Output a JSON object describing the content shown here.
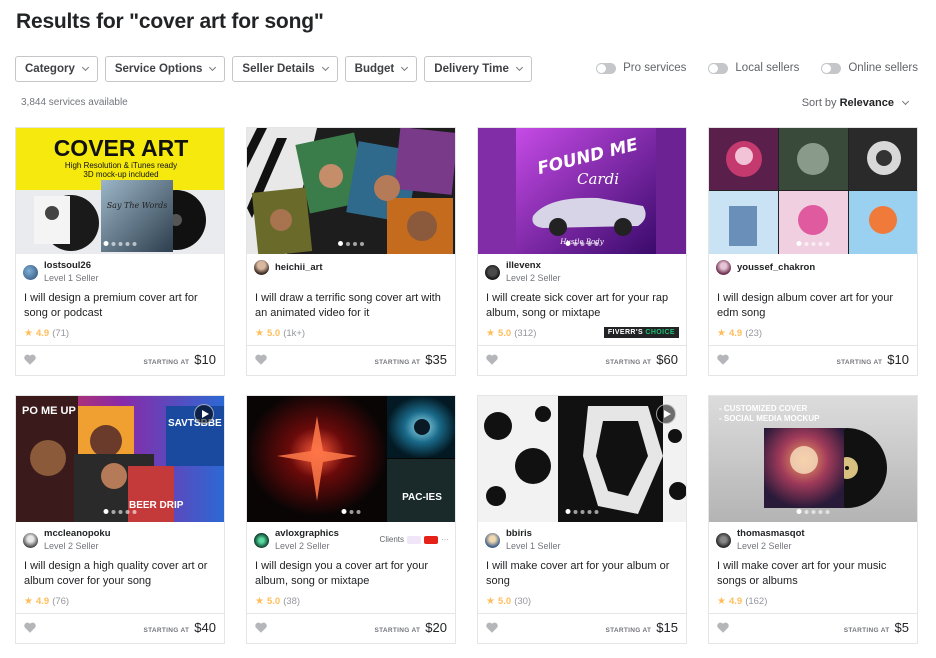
{
  "page": {
    "title": "Results for \"cover art for song\""
  },
  "filters": [
    "Category",
    "Service Options",
    "Seller Details",
    "Budget",
    "Delivery Time"
  ],
  "toggles": [
    "Pro services",
    "Local sellers",
    "Online sellers"
  ],
  "results": {
    "count": "3,844 services available",
    "sort_prefix": "Sort by",
    "sort_value": "Relevance"
  },
  "gigs": [
    {
      "seller": "lostsoul26",
      "level": "Level 1 Seller",
      "title": "I will design a premium cover art for song or podcast",
      "rating": "4.9",
      "reviews": "(71)",
      "price_label": "STARTING AT",
      "price": "$10",
      "thumb_text": [
        "COVER ART",
        "High Resolution & iTunes ready",
        "3D mock-up included",
        "Say The Words"
      ]
    },
    {
      "seller": "heichii_art",
      "level": "",
      "title": "I will draw a terrific song cover art with an animated video for it",
      "rating": "5.0",
      "reviews": "(1k+)",
      "price_label": "STARTING AT",
      "price": "$35"
    },
    {
      "seller": "illevenx",
      "level": "Level 2 Seller",
      "title": "I will create sick cover art for your rap album, song or mixtape",
      "rating": "5.0",
      "reviews": "(312)",
      "price_label": "STARTING AT",
      "price": "$60",
      "badge": [
        "FIVERR'S",
        "CHOICE"
      ],
      "thumb_text": [
        "FOUND ME",
        "Cardi",
        "Hustle Body"
      ]
    },
    {
      "seller": "youssef_chakron",
      "level": "",
      "title": "I will design album cover art for your edm song",
      "rating": "4.9",
      "reviews": "(23)",
      "price_label": "STARTING AT",
      "price": "$10"
    },
    {
      "seller": "mccleanopoku",
      "level": "Level 2 Seller",
      "title": "I will design a high quality cover art or album cover for your song",
      "rating": "4.9",
      "reviews": "(76)",
      "price_label": "STARTING AT",
      "price": "$40",
      "thumb_text": [
        "PO ME UP",
        "SAVTSBBE",
        "BEER DRIP"
      ]
    },
    {
      "seller": "avloxgraphics",
      "level": "Level 2 Seller",
      "title": "I will design you a cover art for your album, song or mixtape",
      "rating": "5.0",
      "reviews": "(38)",
      "price_label": "STARTING AT",
      "price": "$20",
      "clients_label": "Clients",
      "thumb_text": [
        "PAC-IES"
      ]
    },
    {
      "seller": "bbiris",
      "level": "Level 1 Seller",
      "title": "I will make cover art for your album or song",
      "rating": "5.0",
      "reviews": "(30)",
      "price_label": "STARTING AT",
      "price": "$15"
    },
    {
      "seller": "thomasmasqot",
      "level": "Level 2 Seller",
      "title": "I will make cover art for your music songs or albums",
      "rating": "4.9",
      "reviews": "(162)",
      "price_label": "STARTING AT",
      "price": "$5",
      "thumb_text": [
        "- CUSTOMIZED COVER",
        "- SOCIAL MEDIA MOCKUP"
      ]
    }
  ],
  "colors": {
    "star": "#ffbe5b",
    "accent": "#1dbf73",
    "border": "#e4e5e7"
  }
}
